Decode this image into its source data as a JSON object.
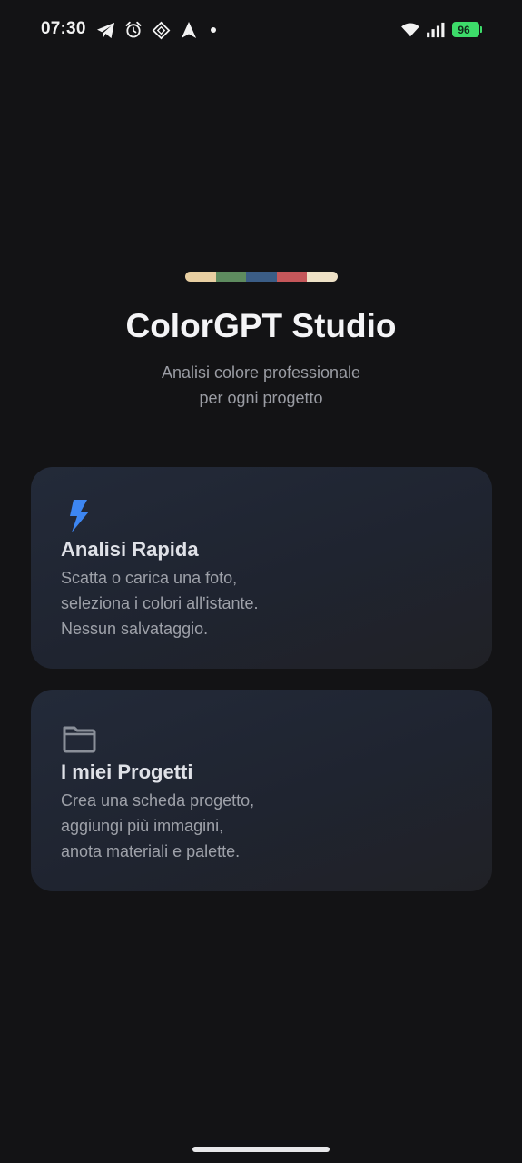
{
  "status_bar": {
    "time": "07:30",
    "battery": "96",
    "icons": [
      "telegram-icon",
      "alarm-icon",
      "app-icon",
      "navigation-icon",
      "dot-icon",
      "wifi-icon",
      "signal-icon",
      "battery-icon"
    ]
  },
  "brand": {
    "palette_colors": [
      "#e8cfa2",
      "#5e8b5f",
      "#3b5d86",
      "#c5575a",
      "#eee1c6"
    ],
    "title": "ColorGPT Studio",
    "subtitle_line1": "Analisi colore professionale",
    "subtitle_line2": "per ogni progetto"
  },
  "cards": [
    {
      "icon": "lightning-icon",
      "icon_color": "#3d86f2",
      "title": "Analisi Rapida",
      "desc_line1": "Scatta o carica una foto,",
      "desc_line2": "seleziona i colori all'istante.",
      "desc_line3": "Nessun salvataggio."
    },
    {
      "icon": "folder-icon",
      "icon_color": "#8a8f99",
      "title": "I miei Progetti",
      "desc_line1": "Crea una scheda progetto,",
      "desc_line2": "aggiungi più immagini,",
      "desc_line3": "anota materiali e palette."
    }
  ]
}
